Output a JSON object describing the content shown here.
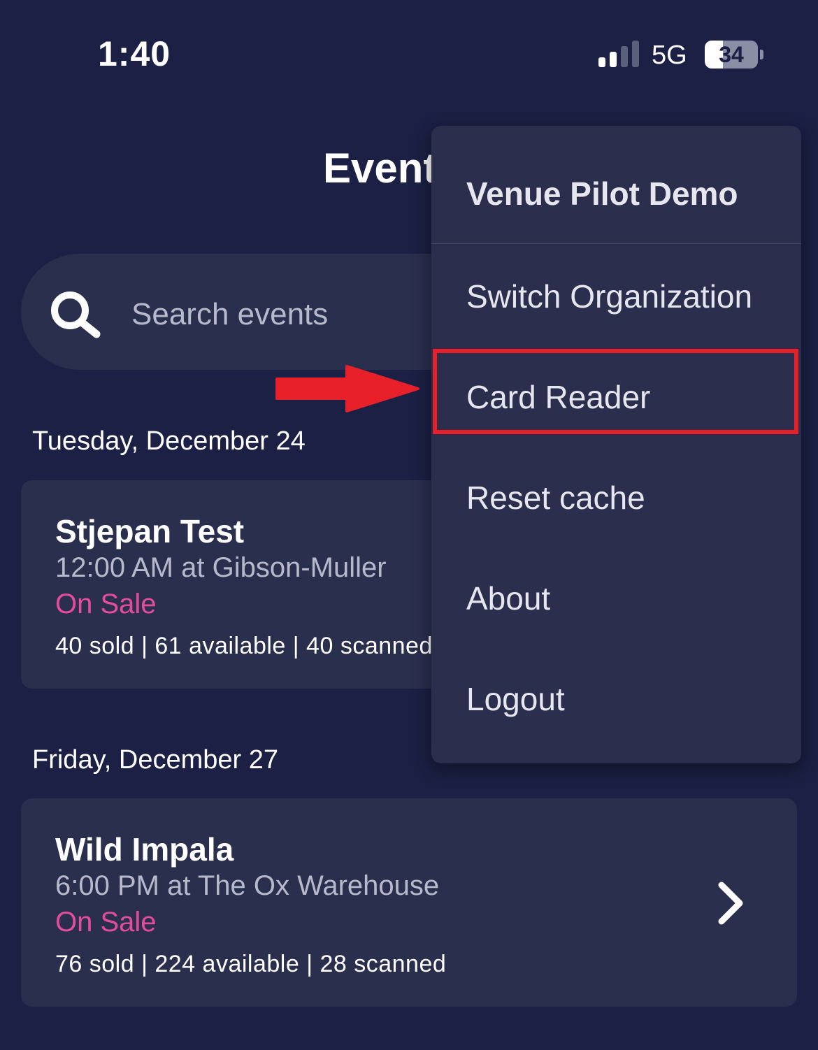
{
  "status_bar": {
    "time": "1:40",
    "network": "5G",
    "battery_level": 34,
    "battery_label": "34"
  },
  "header": {
    "title": "Events"
  },
  "search": {
    "placeholder": "Search events"
  },
  "sections": [
    {
      "date": "Tuesday, December 24",
      "events": [
        {
          "name": "Stjepan Test",
          "time_venue": "12:00 AM at Gibson-Muller",
          "status": "On Sale",
          "stats": "40 sold | 61 available | 40 scanned"
        }
      ]
    },
    {
      "date": "Friday, December 27",
      "events": [
        {
          "name": "Wild Impala",
          "time_venue": "6:00 PM at The Ox Warehouse",
          "status": "On Sale",
          "stats": "76 sold | 224 available | 28 scanned"
        }
      ]
    }
  ],
  "menu": {
    "header": "Venue Pilot Demo",
    "items": [
      "Switch Organization",
      "Card Reader",
      "Reset cache",
      "About",
      "Logout"
    ],
    "highlighted_item": "Card Reader"
  },
  "colors": {
    "background": "#1b2044",
    "card": "#2b2f4e",
    "status_on_sale": "#e44d9b",
    "annotation": "#e8202a"
  }
}
